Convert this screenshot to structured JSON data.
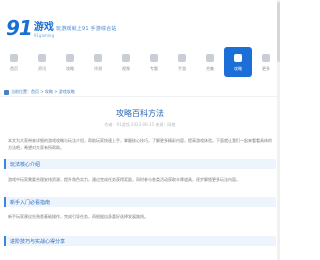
{
  "header": {
    "logo_number": "91",
    "logo_text": "游戏",
    "logo_sub": "91gaming",
    "slogan": "玩游戏就上91 手游综合站"
  },
  "nav": {
    "items": [
      {
        "label": "首页"
      },
      {
        "label": "资讯"
      },
      {
        "label": "攻略"
      },
      {
        "label": "评测"
      },
      {
        "label": "视频"
      },
      {
        "label": "专题"
      },
      {
        "label": "手游"
      },
      {
        "label": "合集"
      },
      {
        "label": "攻略",
        "active": true
      },
      {
        "label": "更多"
      }
    ]
  },
  "breadcrumb": {
    "text": "当前位置：首页 > 攻略 > 游戏攻略"
  },
  "article": {
    "title": "攻略百科方法",
    "meta": "作者：91游戏   2023-06-15   来源：网络",
    "paragraph_1": "本文为大家带来详细的游戏攻略与玩法介绍，帮助玩家快速上手，掌握核心技巧，了解更多精彩内容，提高游戏体验。下面就让我们一起来看看具体的方法吧，希望对大家有所帮助。",
    "section_1": "玩法核心介绍",
    "paragraph_2": "游戏中玩家需要合理安排资源，提升角色实力，通过完成任务获得奖励，同时参与各类活动获取丰厚道具，逐步解锁更多玩法内容。",
    "section_2": "新手入门必看指南",
    "paragraph_3": "新手玩家建议先熟悉基础操作，完成引导任务，再根据自身喜好选择发展路线。",
    "section_3": "进阶技巧与实战心得分享"
  }
}
